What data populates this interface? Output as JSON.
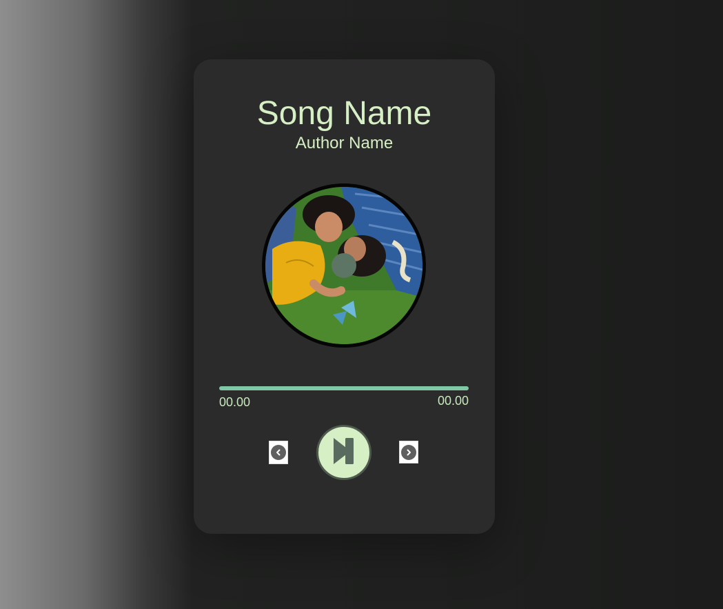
{
  "song": {
    "title": "Song Name",
    "author": "Author Name"
  },
  "cover": {
    "alt": "album art: couple lying on grass"
  },
  "progress": {
    "fraction": 1.0,
    "current_time": "00.00",
    "duration": "00.00"
  },
  "controls": {
    "prev_icon": "chevron-left-icon",
    "play_icon": "play-skip-icon",
    "next_icon": "chevron-right-icon"
  },
  "colors": {
    "accent": "#d6efc4",
    "progress": "#7fc8a6",
    "card": "#2a2b2a",
    "disc_center": "#5d7564"
  }
}
